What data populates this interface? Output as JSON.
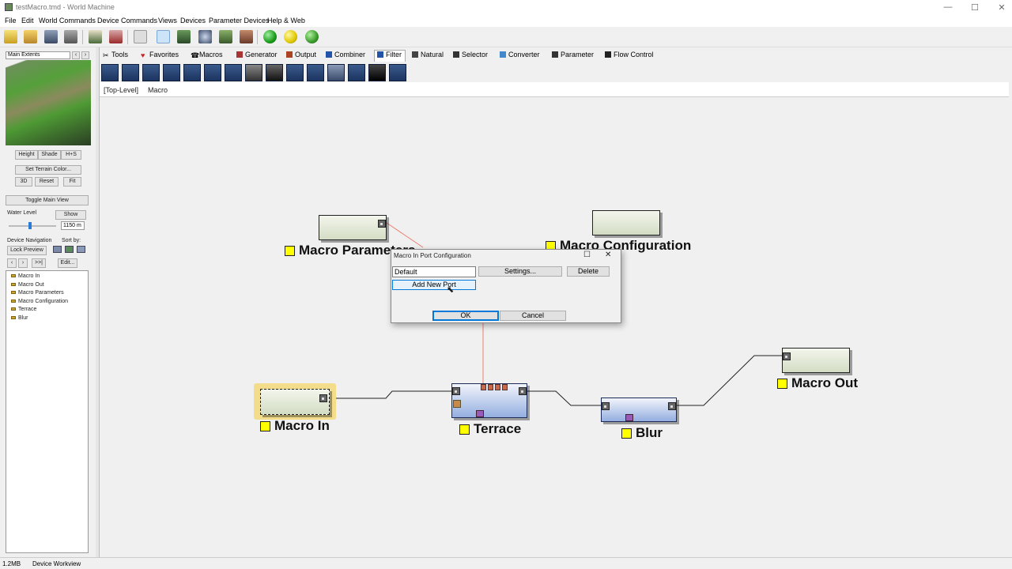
{
  "window": {
    "title": "testMacro.tmd - World Machine",
    "controls": {
      "minimize": "—",
      "maximize": "☐",
      "close": "✕"
    }
  },
  "menu": [
    "File",
    "Edit",
    "World Commands",
    "Device Commands",
    "Views",
    "Devices",
    "Parameter Devices",
    "Help & Web"
  ],
  "toolbar": {
    "icons": [
      "new-file-icon",
      "open-file-icon",
      "save-icon",
      "export-icon",
      "terrain-view-icon",
      "terrain-render-icon",
      "settings-icon",
      "layout-view-icon",
      "device-view-icon",
      "globe-icon",
      "preview-icon",
      "texture-icon",
      "go-green-icon",
      "go-yellow-icon",
      "globe-green-icon"
    ]
  },
  "left_panel": {
    "view_select": "Main Extents",
    "view_nav": [
      "‹",
      "›"
    ],
    "render_modes": [
      "Height",
      "Shade",
      "H+S"
    ],
    "set_terrain_color": "Set Terrain Color...",
    "view_buttons": [
      "3D",
      "Reset",
      "Fit"
    ],
    "toggle_main_view": "Toggle Main View",
    "water_level_label": "Water Level",
    "show_button": "Show",
    "water_level_value": "1150 m",
    "device_navigation_label": "Device Navigation",
    "sort_by_label": "Sort by:",
    "lock_preview": "Lock Preview",
    "nav_buttons": [
      "‹",
      "›",
      ">>|"
    ],
    "edit_button": "Edit...",
    "tree": [
      "Macro In",
      "Macro Out",
      "Macro Parameters",
      "Macro Configuration",
      "Terrace",
      "Blur"
    ]
  },
  "tabs": [
    {
      "label": "Tools",
      "icon": "tools-icon",
      "color": "#333333"
    },
    {
      "label": "Favorites",
      "icon": "heart-icon",
      "color": "#cc2222"
    },
    {
      "label": "Macros",
      "icon": "macro-icon",
      "color": "#444444"
    },
    {
      "label": "Generator",
      "icon": "generator-icon",
      "color": "#aa3333"
    },
    {
      "label": "Output",
      "icon": "output-icon",
      "color": "#aa4422"
    },
    {
      "label": "Combiner",
      "icon": "combiner-icon",
      "color": "#2255aa"
    },
    {
      "label": "Filter",
      "icon": "filter-icon",
      "color": "#2255aa"
    },
    {
      "label": "Natural",
      "icon": "natural-icon",
      "color": "#444444"
    },
    {
      "label": "Selector",
      "icon": "selector-icon",
      "color": "#333333"
    },
    {
      "label": "Converter",
      "icon": "converter-icon",
      "color": "#4488cc"
    },
    {
      "label": "Parameter",
      "icon": "parameter-icon",
      "color": "#333333"
    },
    {
      "label": "Flow Control",
      "icon": "flow-control-icon",
      "color": "#222222"
    }
  ],
  "active_tab": "Filter",
  "device_buttons": [
    "filter-device-1-icon",
    "filter-device-2-icon",
    "filter-device-3-icon",
    "filter-device-4-icon",
    "filter-device-5-icon",
    "filter-device-6-icon",
    "filter-device-7-icon",
    "filter-device-8-icon",
    "filter-device-9-icon",
    "filter-device-10-icon",
    "filter-device-11-icon",
    "filter-device-12-icon",
    "filter-device-13-icon",
    "filter-device-14-icon",
    "filter-device-15-icon"
  ],
  "breadcrumb": [
    "[Top-Level]",
    "Macro"
  ],
  "nodes": {
    "macro_params": "Macro Parameters",
    "macro_config": "Macro Configuration",
    "macro_in": "Macro In",
    "terrace": "Terrace",
    "blur": "Blur",
    "macro_out": "Macro Out"
  },
  "dialog": {
    "title": "Macro In Port Configuration",
    "port_value": "Default",
    "settings": "Settings...",
    "delete": "Delete",
    "add_port": "Add New Port",
    "ok": "OK",
    "cancel": "Cancel"
  },
  "status": {
    "memory": "1.2MB",
    "mode": "Device Workview"
  }
}
